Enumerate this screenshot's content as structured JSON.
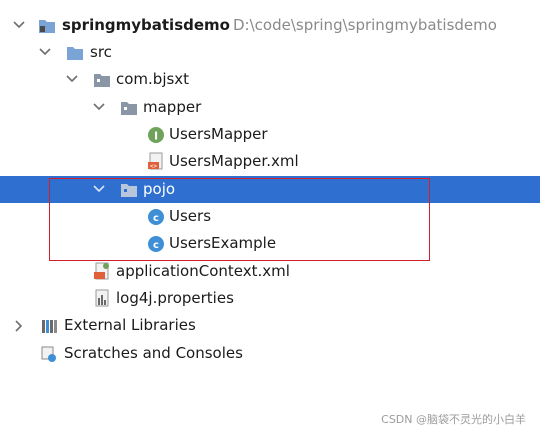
{
  "tree": {
    "project": {
      "name": "springmybatisdemo",
      "path": "D:\\code\\spring\\springmybatisdemo"
    },
    "src": "src",
    "package": "com.bjsxt",
    "mapper": "mapper",
    "users_mapper": "UsersMapper",
    "users_mapper_xml": "UsersMapper.xml",
    "pojo": "pojo",
    "users": "Users",
    "users_example": "UsersExample",
    "app_context": "applicationContext.xml",
    "log4j": "log4j.properties",
    "external_libraries": "External Libraries",
    "scratches": "Scratches and Consoles"
  },
  "colors": {
    "selection": "#2f6fcf",
    "highlight_border": "#d11f2b",
    "folder": "#7aa4d6",
    "interface_icon": "#6fa35b",
    "class_icon": "#3e8fd6"
  },
  "watermark": "CSDN @脑袋不灵光的小白羊"
}
